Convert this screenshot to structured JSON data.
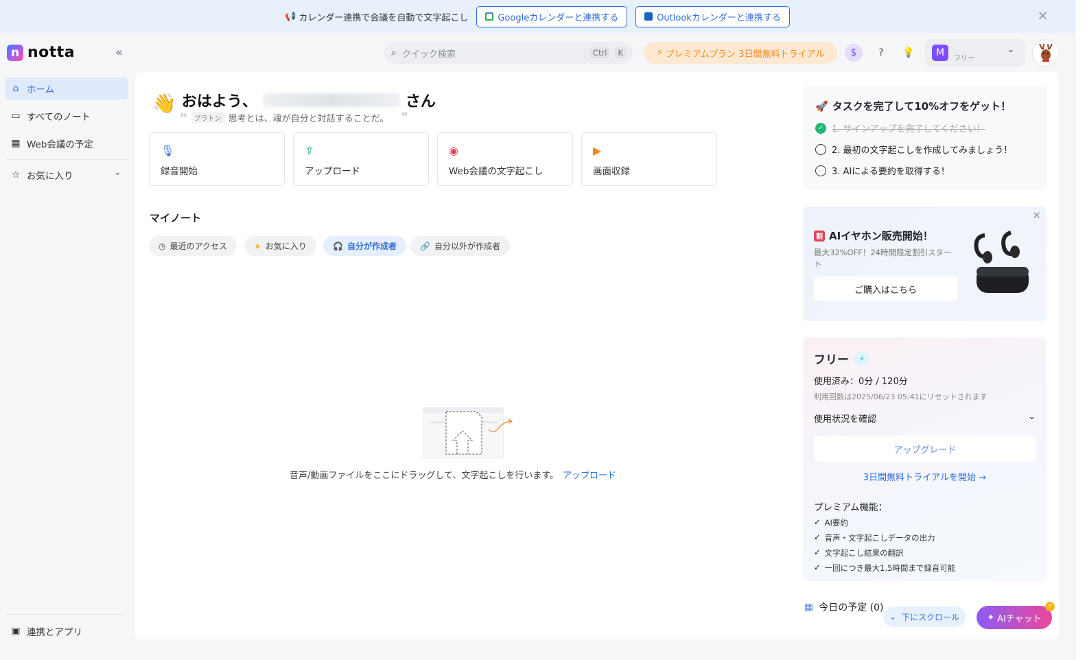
{
  "banner": {
    "message": "カレンダー連携で会議を自動で文字起こし",
    "google_button": "Googleカレンダーと連携する",
    "outlook_button": "Outlookカレンダーと連携する",
    "close": "✕"
  },
  "brand": {
    "logo_letter": "n",
    "name": "notta",
    "collapse": "«"
  },
  "sidebar": {
    "items": [
      {
        "label": "ホーム",
        "icon": "⌂"
      },
      {
        "label": "すべてのノート",
        "icon": "▭"
      },
      {
        "label": "Web会議の予定",
        "icon": "▦"
      }
    ],
    "favorites": {
      "label": "お気に入り",
      "icon": "☆",
      "chevron": "⌄"
    },
    "integrations": {
      "label": "連携とアプリ",
      "icon": "▣"
    }
  },
  "header": {
    "search_placeholder": "クイック検索",
    "shortcut_ctrl": "Ctrl",
    "shortcut_k": "K",
    "premium_trial": "プレミアムプラン 3日間無料トライアル",
    "user_initial": "M",
    "user_plan": "フリー",
    "chevron": "⌄"
  },
  "greeting": {
    "hello": "おはよう、",
    "suffix": "さん",
    "quote_author": "プラトン",
    "quote": "思考とは、魂が自分と対話することだ。"
  },
  "actions": [
    {
      "label": "録音開始",
      "color": "#2f6fdc"
    },
    {
      "label": "アップロード",
      "color": "#22b573"
    },
    {
      "label": "Web会議の文字起こし",
      "color": "#e0445a"
    },
    {
      "label": "画面収録",
      "color": "#f08a1c"
    }
  ],
  "notes": {
    "title": "マイノート",
    "filters": [
      "最近のアクセス",
      "お気に入り",
      "自分が作成者",
      "自分以外が作成者"
    ],
    "empty_text": "音声/動画ファイルをここにドラッグして、文字起こしを行います。",
    "empty_link": "アップロード"
  },
  "tasks": {
    "title": "タスクを完了して10%オフをゲット！",
    "items": [
      {
        "text": "1. サインアップを完了してください！",
        "done": true
      },
      {
        "text": "2. 最初の文字起こしを作成してみましょう！",
        "done": false
      },
      {
        "text": "3. AIによる要約を取得する！",
        "done": false
      }
    ]
  },
  "promo": {
    "title": "AIイヤホン販売開始！",
    "subtitle": "最大32%OFF！24時間限定割引スタート",
    "button": "ご購入はこちら",
    "close": "✕"
  },
  "plan": {
    "name": "フリー",
    "used": "使用済み：0分 / 120分",
    "reset": "利用回数は2025/06/23 05:41にリセットされます",
    "status": "使用状況を確認",
    "upgrade": "アップグレード",
    "trial": "3日間無料トライアルを開始 →",
    "features_title": "プレミアム機能：",
    "features": [
      "AI要約",
      "音声・文字起こしデータの出力",
      "文字起こし結果の翻訳",
      "一回につき最大1.5時間まで録音可能"
    ]
  },
  "today": {
    "label": "今日の予定 (0)"
  },
  "floating": {
    "scroll_down": "下にスクロール",
    "ai_chat": "AIチャット"
  }
}
